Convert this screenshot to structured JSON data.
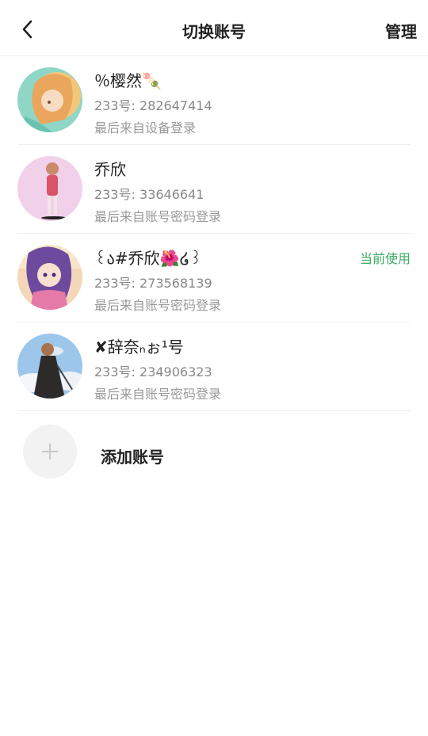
{
  "header": {
    "title": "切换账号",
    "manage_label": "管理",
    "back_icon": "chevron-left-icon"
  },
  "accounts": [
    {
      "name": "％樱然🍡",
      "uid": "233号: 282647414",
      "login": "最后来自设备登录",
      "current": ""
    },
    {
      "name": "乔欣",
      "uid": "233号: 33646641",
      "login": "最后来自账号密码登录",
      "current": ""
    },
    {
      "name": "꒰ა#乔欣🌺໒꒱",
      "uid": "233号: 273568139",
      "login": "最后来自账号密码登录",
      "current": "当前使用"
    },
    {
      "name": "✘辞奈ₙぉ¹号",
      "uid": "233号: 234906323",
      "login": "最后来自账号密码登录",
      "current": ""
    }
  ],
  "add_account": {
    "label": "添加账号",
    "icon": "plus-icon"
  },
  "colors": {
    "current_tag": "#3caa63",
    "secondary_text": "#888888",
    "divider": "#efefef"
  }
}
